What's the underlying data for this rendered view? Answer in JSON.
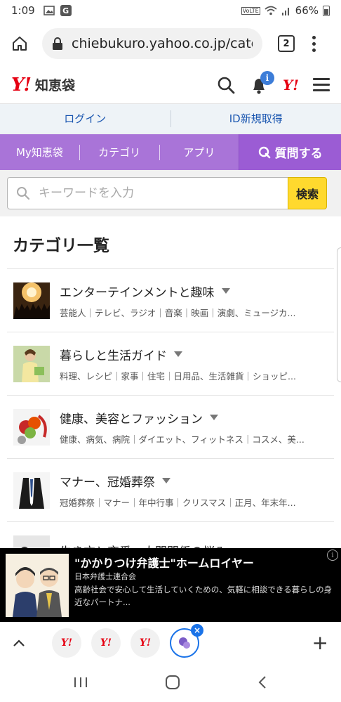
{
  "status_bar": {
    "time": "1:09",
    "notif_icon": "G",
    "network": "VoLTE",
    "battery": "66%"
  },
  "browser": {
    "url": "chiebukuro.yahoo.co.jp/categ",
    "tab_count": "2"
  },
  "site_header": {
    "logo_mark": "Y!",
    "logo_text": "知恵袋",
    "notification_count": "i",
    "yahoo_mark": "Y!"
  },
  "account": {
    "login_label": "ログイン",
    "signup_label": "ID新規取得"
  },
  "nav": {
    "items": [
      {
        "label": "My知恵袋"
      },
      {
        "label": "カテゴリ"
      },
      {
        "label": "アプリ"
      }
    ],
    "ask_label": "質問する"
  },
  "search": {
    "placeholder": "キーワードを入力",
    "button_label": "検索",
    "value": ""
  },
  "category_section": {
    "title": "カテゴリ一覧",
    "items": [
      {
        "name": "エンターテインメントと趣味",
        "subs": "芸能人｜テレビ、ラジオ｜音楽｜映画｜演劇、ミュージカ..."
      },
      {
        "name": "暮らしと生活ガイド",
        "subs": "料理、レシピ｜家事｜住宅｜日用品、生活雑貨｜ショッピ..."
      },
      {
        "name": "健康、美容とファッション",
        "subs": "健康、病気、病院｜ダイエット、フィットネス｜コスメ、美..."
      },
      {
        "name": "マナー、冠婚葬祭",
        "subs": "冠婚葬祭｜マナー｜年中行事｜クリスマス｜正月、年末年..."
      },
      {
        "name": "生き方と恋愛、人間関係の悩み",
        "subs": ""
      }
    ]
  },
  "ad": {
    "title": "\"かかりつけ弁護士\"ホームロイヤー",
    "sponsor": "日本弁護士連合会",
    "body": "高齢社会で安心して生活していくための、気軽に相談できる暮らしの身近なパートナ..."
  },
  "tabs": {
    "tab_mark": "Y!"
  },
  "colors": {
    "accent_purple": "#a974d8",
    "ask_purple": "#9b5cd4",
    "yahoo_red": "#e60012",
    "search_yellow": "#ffd92e",
    "link_blue": "#1a56b0"
  }
}
